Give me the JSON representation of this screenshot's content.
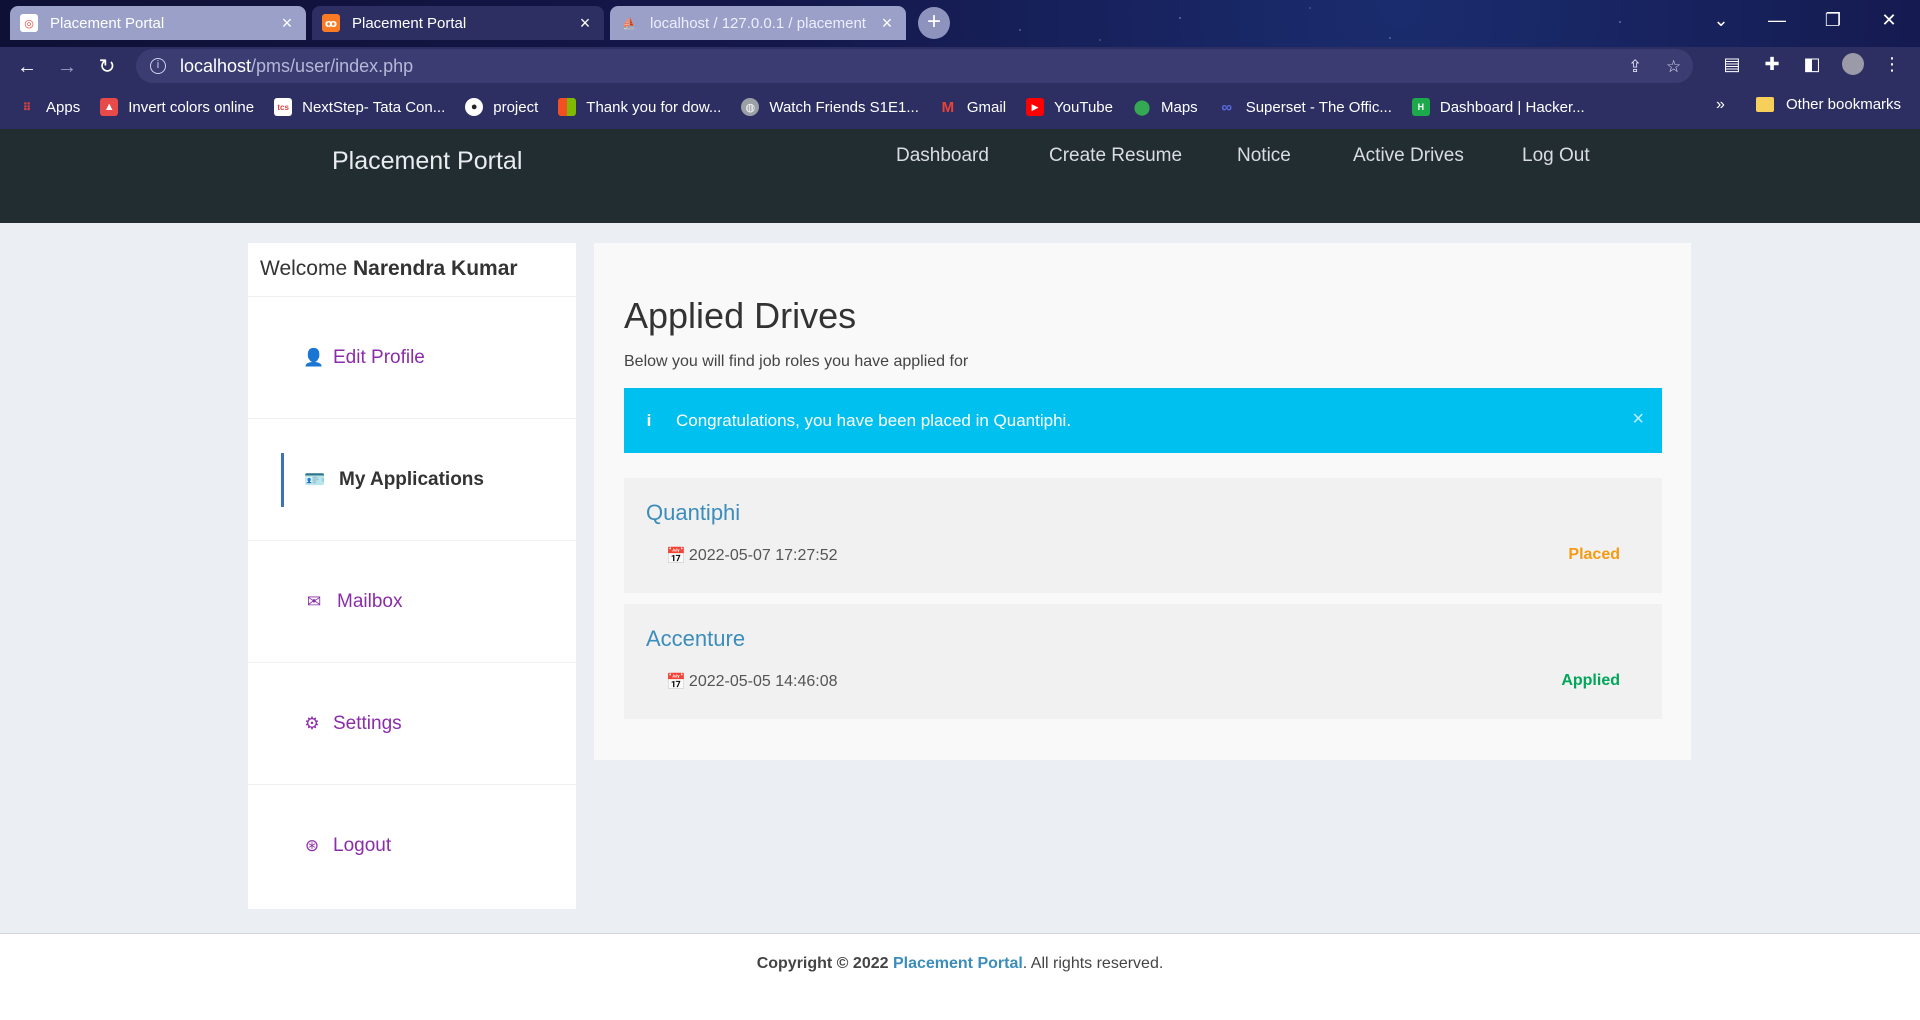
{
  "browser": {
    "tabs": [
      {
        "title": "Placement Portal",
        "active": false
      },
      {
        "title": "Placement Portal",
        "active": true
      },
      {
        "title": "localhost / 127.0.0.1 / placement",
        "active": false
      }
    ],
    "url_host": "localhost",
    "url_path": "/pms/user/index.php",
    "bookmarks": [
      {
        "label": "Apps",
        "icon": "apps-grid-icon",
        "color": "#e8453c"
      },
      {
        "label": "Invert colors online",
        "icon": "invert-colors-icon",
        "color": "#e84a4a"
      },
      {
        "label": "NextStep- Tata Con...",
        "icon": "tcs-icon",
        "color": "#e04040"
      },
      {
        "label": "project",
        "icon": "github-icon",
        "color": "#ffffff"
      },
      {
        "label": "Thank you for dow...",
        "icon": "microsoft-icon",
        "color": "#f25022"
      },
      {
        "label": "Watch Friends S1E1...",
        "icon": "globe-icon",
        "color": "#9aa0a6"
      },
      {
        "label": "Gmail",
        "icon": "gmail-icon",
        "color": "#ea4335"
      },
      {
        "label": "YouTube",
        "icon": "youtube-icon",
        "color": "#ff0000"
      },
      {
        "label": "Maps",
        "icon": "maps-pin-icon",
        "color": "#34a853"
      },
      {
        "label": "Superset - The Offic...",
        "icon": "superset-icon",
        "color": "#5b6ee1"
      },
      {
        "label": "Dashboard | Hacker...",
        "icon": "hackerrank-icon",
        "color": "#1ba94c"
      }
    ],
    "bookmarks_overflow": "»",
    "other_bookmarks": "Other bookmarks"
  },
  "header": {
    "brand": "Placement Portal",
    "nav": [
      "Dashboard",
      "Create Resume",
      "Notice",
      "Active Drives",
      "Log Out"
    ]
  },
  "sidebar": {
    "welcome_prefix": "Welcome",
    "user_name": "Narendra Kumar",
    "items": [
      {
        "label": "Edit Profile",
        "icon": "user-icon"
      },
      {
        "label": "My Applications",
        "icon": "id-card-icon"
      },
      {
        "label": "Mailbox",
        "icon": "envelope-icon"
      },
      {
        "label": "Settings",
        "icon": "gear-icon"
      },
      {
        "label": "Logout",
        "icon": "logout-circle-icon"
      }
    ]
  },
  "main": {
    "title": "Applied Drives",
    "subtitle": "Below you will find job roles you have applied for",
    "alert": {
      "message": "Congratulations, you have been placed in Quantiphi.",
      "color": "#00c0ef"
    },
    "drives": [
      {
        "company": "Quantiphi",
        "date": "2022-05-07 17:27:52",
        "status": "Placed",
        "status_color": "#f39c12"
      },
      {
        "company": "Accenture",
        "date": "2022-05-05 14:46:08",
        "status": "Applied",
        "status_color": "#00a65a"
      }
    ]
  },
  "footer": {
    "copyright": "Copyright © 2022",
    "site_name": "Placement Portal",
    "rights": ". All rights reserved."
  },
  "colors": {
    "header_bg": "#222d32",
    "link": "#3c8dbc",
    "sidebar_accent": "#8b2da8"
  }
}
